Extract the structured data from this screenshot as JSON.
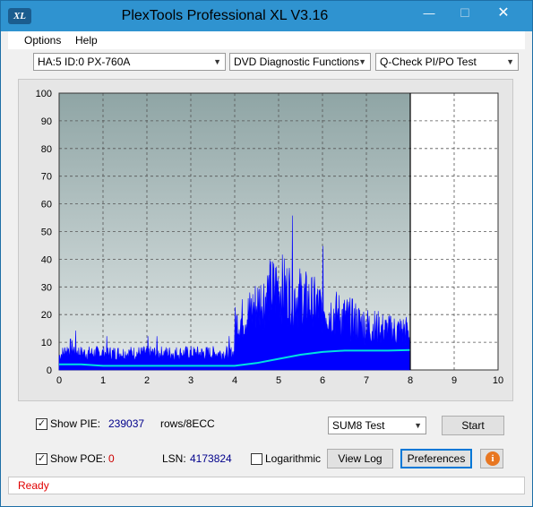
{
  "window": {
    "title": "PlexTools Professional XL V3.16",
    "icon_text": "XL"
  },
  "menu": {
    "items": [
      {
        "label": "Options"
      },
      {
        "label": "Help"
      }
    ]
  },
  "toolbar": {
    "drive": "HA:5 ID:0  PX-760A",
    "function": "DVD Diagnostic Functions",
    "test": "Q-Check PI/PO Test"
  },
  "chart_data": {
    "type": "area",
    "xlim": [
      0,
      10
    ],
    "ylim": [
      0,
      100
    ],
    "x_ticks": [
      "0",
      "1",
      "2",
      "3",
      "4",
      "5",
      "6",
      "7",
      "8",
      "9",
      "10"
    ],
    "y_ticks": [
      "0",
      "10",
      "20",
      "30",
      "40",
      "50",
      "60",
      "70",
      "80",
      "90",
      "100"
    ],
    "grid": true,
    "marker_x": 8,
    "series": [
      {
        "color": "#0000ff",
        "x": [
          0,
          0.25,
          0.5,
          1,
          1.5,
          2,
          2.5,
          3,
          3.5,
          3.99,
          4.0,
          4.3,
          4.6,
          4.8,
          5.0,
          5.2,
          5.5,
          6.0,
          6.5,
          7.0,
          7.5,
          7.9,
          8.0
        ],
        "values": [
          5,
          8,
          6,
          6,
          6,
          6,
          6,
          6,
          6,
          6,
          16,
          20,
          25,
          28,
          30,
          28,
          26,
          22,
          19,
          16,
          14,
          14,
          12
        ]
      },
      {
        "color": "#00e0e0",
        "x": [
          0,
          0.5,
          1,
          2,
          3,
          4,
          4.5,
          5,
          5.5,
          6,
          6.5,
          7,
          7.5,
          8
        ],
        "values": [
          2,
          2,
          1.5,
          1.5,
          1.5,
          1.5,
          2.5,
          4,
          5.5,
          6.5,
          7,
          7,
          7,
          7.2
        ]
      }
    ]
  },
  "controls": {
    "show_pie": {
      "label": "Show PIE:",
      "checked": "✓",
      "value": "239037",
      "unit": "rows/8ECC"
    },
    "show_poe": {
      "label": "Show POE:",
      "checked": "✓",
      "value": "0"
    },
    "lsn": {
      "label": "LSN:",
      "value": "4173824"
    },
    "logarithmic": {
      "label": "Logarithmic"
    },
    "sum_select": "SUM8 Test",
    "start_button": "Start",
    "viewlog_button": "View Log",
    "preferences_button": "Preferences"
  },
  "status": {
    "text": "Ready"
  },
  "colors": {
    "plot_bg_top": "#8fa5a5",
    "plot_bg_bottom": "#e2e8e8",
    "pie_fill": "#0000ff",
    "sum_line": "#00e0e0"
  }
}
